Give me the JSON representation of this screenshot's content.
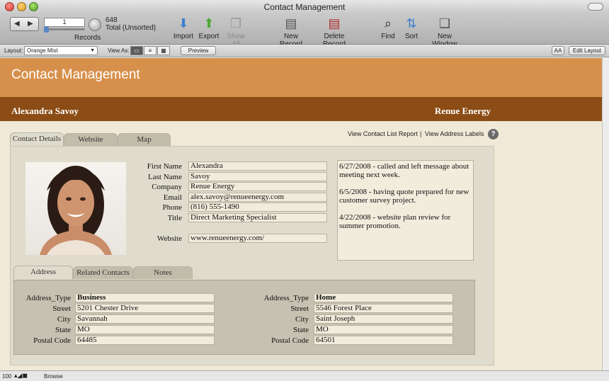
{
  "window": {
    "title": "Contact Management"
  },
  "toolbar": {
    "record_number": "1",
    "records_label": "Records",
    "found_count": "648",
    "found_total": "Total (Unsorted)",
    "buttons": [
      {
        "label": "Import",
        "icon": "import-icon"
      },
      {
        "label": "Export",
        "icon": "export-icon"
      },
      {
        "label": "Show All",
        "icon": "show-all-icon"
      },
      {
        "label": "New Record",
        "icon": "new-record-icon"
      },
      {
        "label": "Delete Record",
        "icon": "delete-record-icon"
      },
      {
        "label": "Find",
        "icon": "find-icon"
      },
      {
        "label": "Sort",
        "icon": "sort-icon"
      },
      {
        "label": "New Window",
        "icon": "new-window-icon"
      }
    ]
  },
  "layoutbar": {
    "layout_label": "Layout:",
    "layout_value": "Orange Mist",
    "view_as_label": "View As:",
    "preview_label": "Preview",
    "text_size_label": "AA",
    "edit_layout_label": "Edit Layout"
  },
  "header": {
    "app_title": "Contact Management",
    "contact_name": "Alexandra Savoy",
    "company": "Renue Energy"
  },
  "tabs": [
    "Contact Details",
    "Website",
    "Map"
  ],
  "links": {
    "report": "View Contact List Report",
    "separator": "|",
    "labels": "View Address Labels"
  },
  "fields": [
    {
      "label": "First Name",
      "value": "Alexandra"
    },
    {
      "label": "Last Name",
      "value": "Savoy"
    },
    {
      "label": "Company",
      "value": "Renue Energy"
    },
    {
      "label": "Email",
      "value": "alex.savoy@renueenergy.com"
    },
    {
      "label": "Phone",
      "value": "(816) 555-1490"
    },
    {
      "label": "Title",
      "value": "Direct Marketing Specialist"
    }
  ],
  "website": {
    "label": "Website",
    "value": "www.renueenergy.com/"
  },
  "notes": [
    "6/27/2008 - called and left message about meeting next week.",
    "6/5/2008 - having quote prepared for new customer survey project.",
    "4/22/2008 - website plan review for summer promotion."
  ],
  "subtabs": [
    "Address",
    "Related Contacts",
    "Notes"
  ],
  "address_labels": [
    "Address_Type",
    "Street",
    "City",
    "State",
    "Postal Code"
  ],
  "addresses": [
    {
      "type": "Business",
      "street": "5201 Chester Drive",
      "city": "Savannah",
      "state": "MO",
      "postal": "64485"
    },
    {
      "type": "Home",
      "street": "5546 Forest Place",
      "city": "Saint Joseph",
      "state": "MO",
      "postal": "64501"
    }
  ],
  "status": {
    "zoom": "100",
    "mode": "Browse"
  },
  "colors": {
    "header": "#d7904b",
    "name_band": "#8b4c15",
    "background": "#f0e9d7",
    "panel": "#e0dccd"
  }
}
